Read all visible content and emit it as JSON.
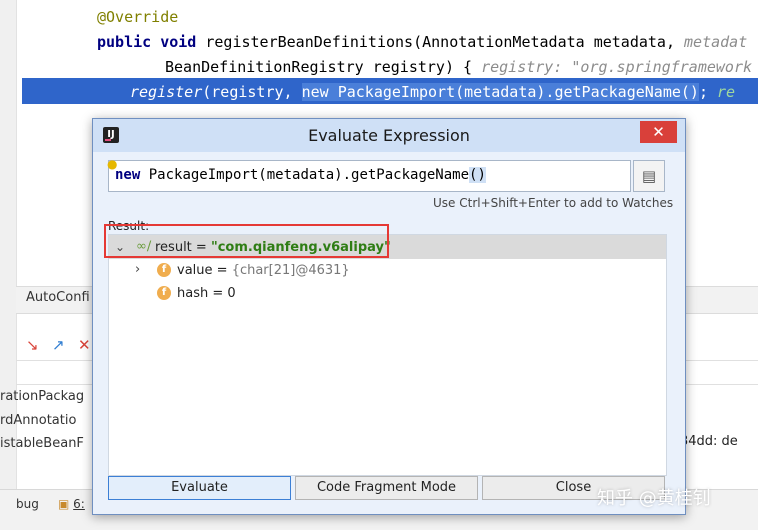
{
  "editor": {
    "line_override": "@Override",
    "line_sig_1_kw": "public void",
    "line_sig_1": "registerBeanDefinitions(AnnotationMetadata metadata,",
    "line_sig_1_hint": "metadat",
    "line_sig_2": "BeanDefinitionRegistry registry) {",
    "line_sig_2_hint": "registry: \"org.springframework",
    "exec_method": "register",
    "exec_args": "(registry, ",
    "exec_selected": "new PackageImport(metadata).getPackageName()",
    "exec_end": ";",
    "exec_hint": "re"
  },
  "background": {
    "panel_tab": "AutoConfi",
    "rows": [
      "rationPackag",
      "rdAnnotatio",
      "istableBeanF"
    ],
    "right_value": "34dd: de",
    "bottom_tabs": [
      "bug",
      "6:"
    ]
  },
  "dialog": {
    "title": "Evaluate Expression",
    "close_label": "✕",
    "expression_kw": "new",
    "expression_body": " PackageImport(metadata).getPackageName",
    "expression_paren": "()",
    "watch_hint": "Use Ctrl+Shift+Enter to add to Watches",
    "result_label": "Result:",
    "result": {
      "name": "result",
      "eq": " = ",
      "value": "\"com.qianfeng.v6alipay\"",
      "children": [
        {
          "name": "value",
          "eq": " = ",
          "value": "{char[21]@4631}"
        },
        {
          "name": "hash",
          "eq": " = ",
          "value": "0"
        }
      ]
    },
    "buttons": {
      "evaluate": "Evaluate",
      "code_fragment": "Code Fragment Mode",
      "close": "Close"
    },
    "badge_letter": "f"
  },
  "watermark": "知乎 @黄桂钊"
}
